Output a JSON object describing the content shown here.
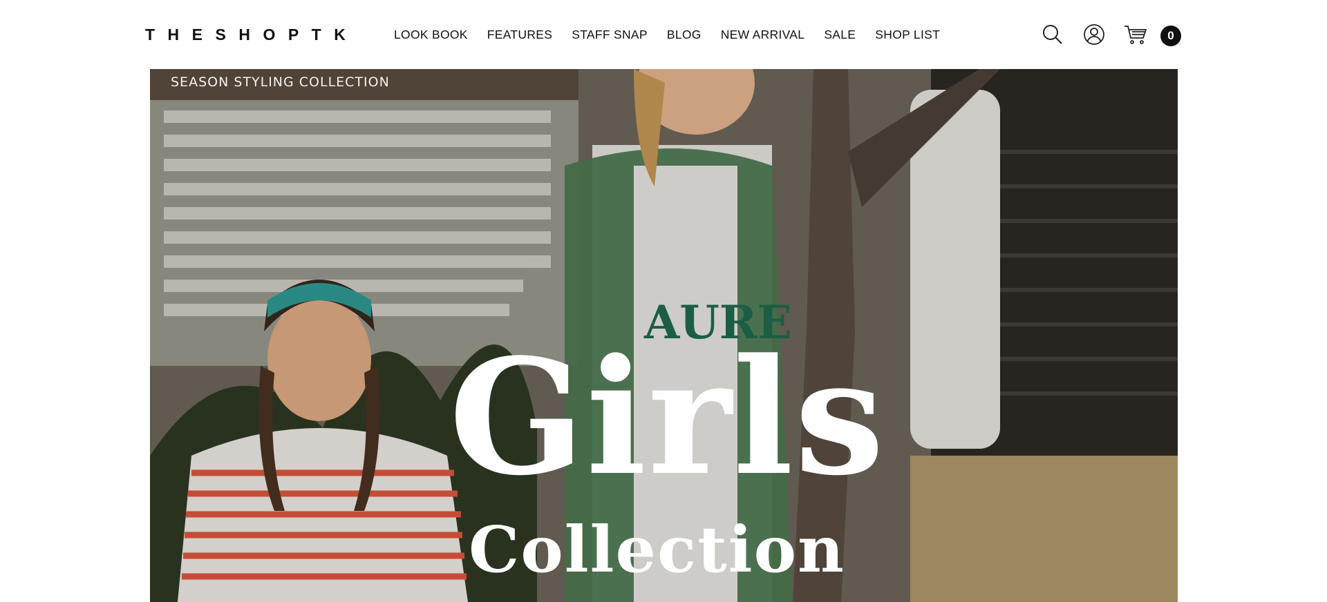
{
  "header": {
    "logo": "THESHOPTK",
    "nav": [
      {
        "label": "LOOK BOOK"
      },
      {
        "label": "FEATURES"
      },
      {
        "label": "STAFF SNAP"
      },
      {
        "label": "BLOG"
      },
      {
        "label": "NEW ARRIVAL"
      },
      {
        "label": "SALE"
      },
      {
        "label": "SHOP LIST"
      }
    ],
    "icons": {
      "search": "search-icon",
      "account": "account-icon",
      "cart": "cart-icon"
    },
    "cart_count": "0"
  },
  "hero": {
    "eyebrow": "SEASON STYLING COLLECTION",
    "title": "Girls",
    "subtitle": "Collection"
  },
  "colors": {
    "text": "#111111",
    "background": "#ffffff",
    "hero_text": "#ffffff",
    "badge": "#111111"
  }
}
